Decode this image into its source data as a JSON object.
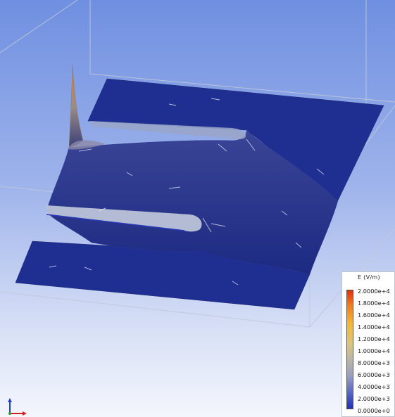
{
  "legend": {
    "title": "E (V/m)",
    "ticks": [
      "2.0000e+4",
      "1.8000e+4",
      "1.6000e+4",
      "1.4000e+4",
      "1.2000e+4",
      "1.0000e+4",
      "8.0000e+3",
      "6.0000e+3",
      "4.0000e+3",
      "2.0000e+3",
      "0.0000e+0"
    ],
    "color_min": "#2230b8",
    "color_max": "#e03010"
  },
  "scene": {
    "background_top": "#6f8fe0",
    "background_bottom": "#f4f6fd",
    "surface_color": "#1e2d8c",
    "spike_color": "#c9a870"
  },
  "axis_triad": {
    "icon": "axis-triad-icon",
    "x_color": "#d02020",
    "y_color": "#2040d0"
  }
}
